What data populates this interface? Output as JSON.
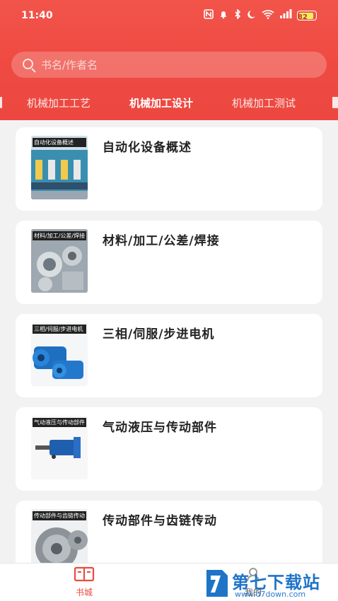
{
  "status_bar": {
    "time": "11:40",
    "battery": "82",
    "icons": [
      "nfc-icon",
      "alarm-icon",
      "bluetooth-icon",
      "moon-icon",
      "wifi-icon",
      "signal-icon"
    ]
  },
  "colors": {
    "header": "#ef4a42",
    "active_nav": "#e84c3d",
    "watermark": "#1f74c8"
  },
  "search": {
    "placeholder": "书名/作者名"
  },
  "tabs": [
    {
      "label": "机械加工工艺",
      "active": false
    },
    {
      "label": "机械加工设计",
      "active": true
    },
    {
      "label": "机械加工测试",
      "active": false
    }
  ],
  "books": [
    {
      "title": "自动化设备概述",
      "cover_label": "自动化设备概述"
    },
    {
      "title": "材料/加工/公差/焊接",
      "cover_label": "材料/加工/公差/焊接"
    },
    {
      "title": "三相/伺服/步进电机",
      "cover_label": "三相/伺服/步进电机"
    },
    {
      "title": "气动液压与传动部件",
      "cover_label": "气动液压与传动部件"
    },
    {
      "title": "传动部件与齿链传动",
      "cover_label": "传动部件与齿链传动"
    }
  ],
  "bottom_nav": [
    {
      "label": "书城",
      "icon": "book-icon",
      "active": true
    },
    {
      "label": "我的",
      "icon": "user-icon",
      "active": false
    }
  ],
  "watermark": {
    "text": "第七下载站",
    "url": "www.d7down.com"
  }
}
